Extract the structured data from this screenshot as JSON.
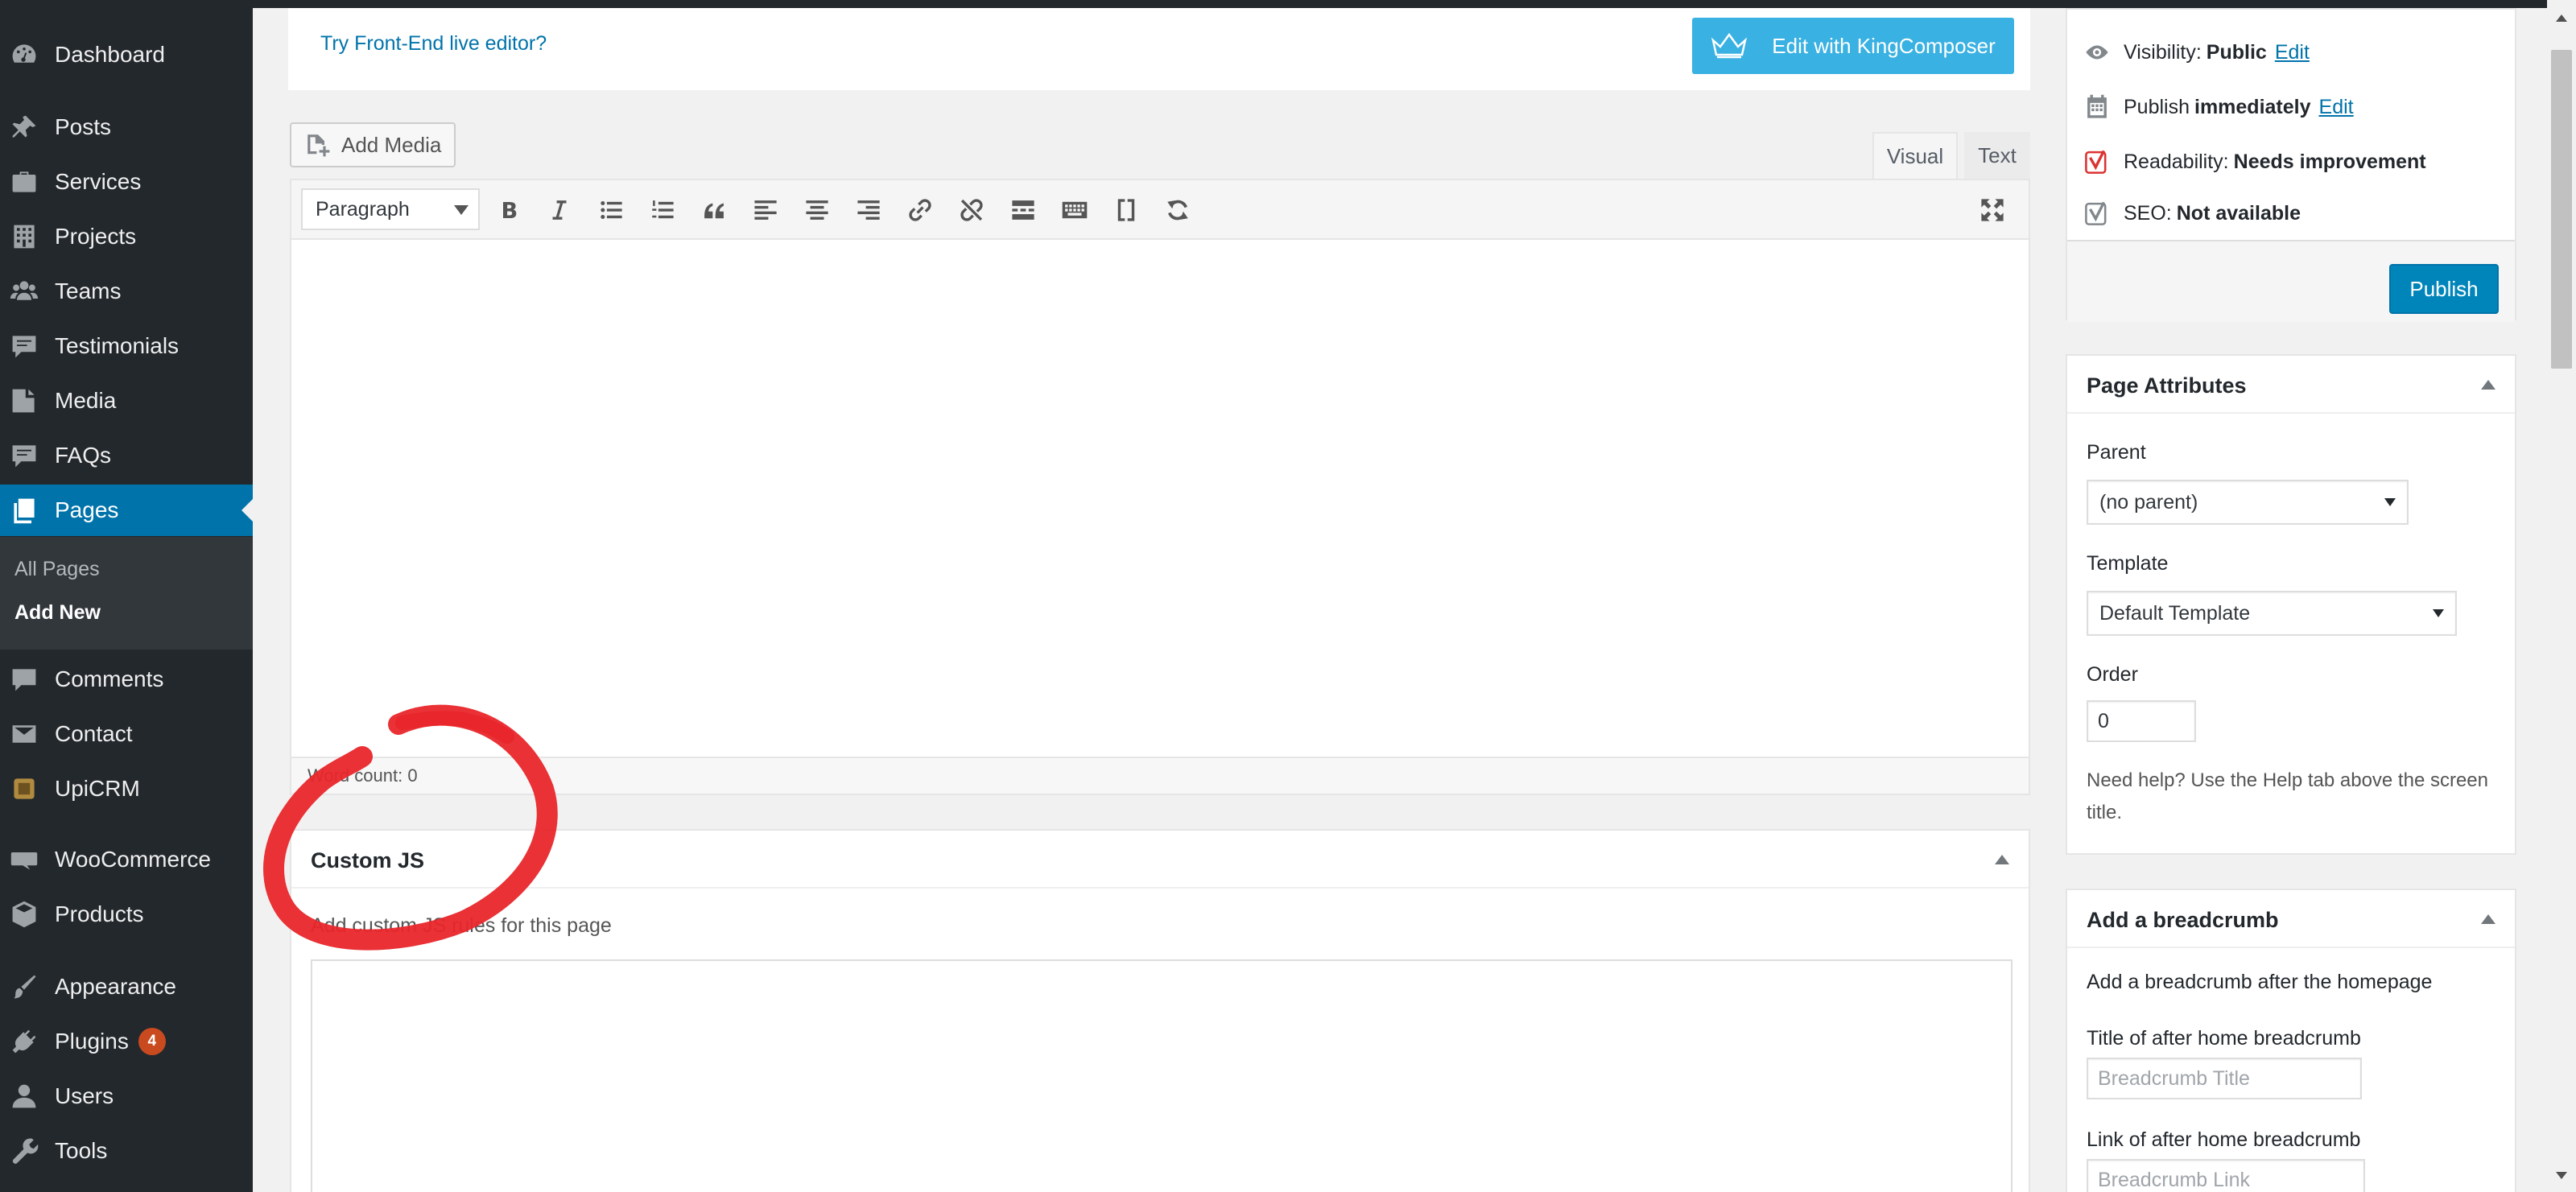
{
  "sidebar": {
    "items": [
      {
        "label": "Dashboard",
        "icon": "dashboard-icon"
      },
      {
        "label": "Posts",
        "icon": "pin-icon"
      },
      {
        "label": "Services",
        "icon": "briefcase-icon"
      },
      {
        "label": "Projects",
        "icon": "building-icon"
      },
      {
        "label": "Teams",
        "icon": "groups-icon"
      },
      {
        "label": "Testimonials",
        "icon": "comment-icon"
      },
      {
        "label": "Media",
        "icon": "media-icon"
      },
      {
        "label": "FAQs",
        "icon": "comment-icon"
      },
      {
        "label": "Pages",
        "icon": "pages-icon"
      },
      {
        "label": "Comments",
        "icon": "comment-icon"
      },
      {
        "label": "Contact",
        "icon": "mail-icon"
      },
      {
        "label": "UpiCRM",
        "icon": "crm-icon"
      },
      {
        "label": "WooCommerce",
        "icon": "woo-icon"
      },
      {
        "label": "Products",
        "icon": "box-icon"
      },
      {
        "label": "Appearance",
        "icon": "brush-icon"
      },
      {
        "label": "Plugins",
        "icon": "plug-icon",
        "badge": "4"
      },
      {
        "label": "Users",
        "icon": "user-icon"
      },
      {
        "label": "Tools",
        "icon": "wrench-icon"
      }
    ],
    "submenu": [
      {
        "label": "All Pages"
      },
      {
        "label": "Add New"
      }
    ]
  },
  "kingcomposer": {
    "live_link": "Try Front-End live editor?",
    "button_label": "Edit with KingComposer"
  },
  "editor": {
    "add_media_label": "Add Media",
    "tabs": {
      "visual": "Visual",
      "text": "Text"
    },
    "format_select": "Paragraph",
    "toolbar_icons": [
      "bold-icon",
      "italic-icon",
      "bulleted-list-icon",
      "numbered-list-icon",
      "blockquote-icon",
      "align-left-icon",
      "align-center-icon",
      "align-right-icon",
      "link-icon",
      "unlink-icon",
      "read-more-icon",
      "toolbar-toggle-icon",
      "shortcode-icon",
      "refresh-icon",
      "fullscreen-icon"
    ],
    "word_count": "Word count: 0"
  },
  "custom_js": {
    "title": "Custom JS",
    "description": "Add custom JS rules for this page"
  },
  "publish": {
    "visibility_label": "Visibility:",
    "visibility_value": "Public",
    "publish_label": "Publish",
    "publish_value": "immediately",
    "edit_link": "Edit",
    "readability_label": "Readability:",
    "readability_value": "Needs improvement",
    "seo_label": "SEO:",
    "seo_value": "Not available",
    "publish_button": "Publish"
  },
  "page_attributes": {
    "title": "Page Attributes",
    "parent_label": "Parent",
    "parent_value": "(no parent)",
    "template_label": "Template",
    "template_value": "Default Template",
    "order_label": "Order",
    "order_value": "0",
    "help": "Need help? Use the Help tab above the screen title."
  },
  "breadcrumb": {
    "title": "Add a breadcrumb",
    "description": "Add a breadcrumb after the homepage",
    "title_label": "Title of after home breadcrumb",
    "title_placeholder": "Breadcrumb Title",
    "link_label": "Link of after home breadcrumb",
    "link_placeholder": "Breadcrumb Link"
  },
  "colors": {
    "sidebar_bg": "#23282d",
    "active_menu": "#0073aa",
    "primary_button": "#0085ba",
    "kingcomposer_button": "#39b1e2",
    "badge": "#ca4a1f",
    "annotation": "#e8262b",
    "readability_red": "#dc3232"
  }
}
